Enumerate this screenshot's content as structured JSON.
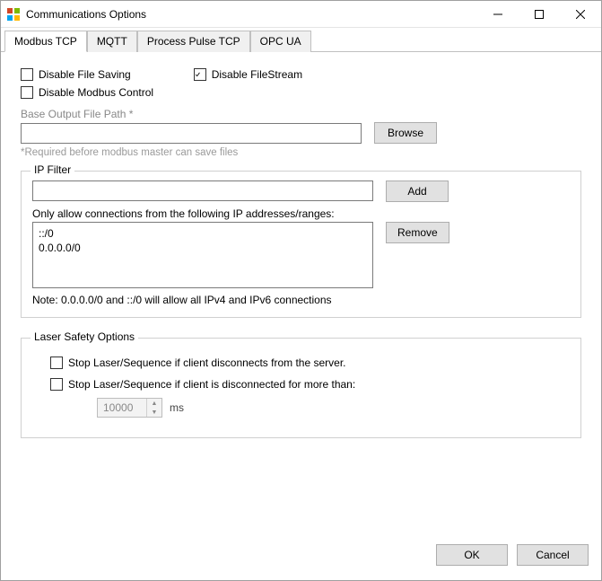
{
  "window": {
    "title": "Communications Options"
  },
  "tabs": {
    "items": [
      {
        "label": "Modbus TCP",
        "active": true
      },
      {
        "label": "MQTT",
        "active": false
      },
      {
        "label": "Process Pulse TCP",
        "active": false
      },
      {
        "label": "OPC UA",
        "active": false
      }
    ]
  },
  "options": {
    "disable_file_saving": {
      "label": "Disable File Saving",
      "checked": false
    },
    "disable_filestream": {
      "label": "Disable FileStream",
      "checked": true
    },
    "disable_modbus_control": {
      "label": "Disable Modbus Control",
      "checked": false
    }
  },
  "base_output": {
    "label": "Base Output File Path *",
    "value": "",
    "browse": "Browse",
    "hint": "*Required before modbus master can save files"
  },
  "ip_filter": {
    "legend": "IP Filter",
    "input_value": "",
    "add": "Add",
    "list_label": "Only allow connections from the following IP addresses/ranges:",
    "entries": [
      "::/0",
      "0.0.0.0/0"
    ],
    "remove": "Remove",
    "note": "Note: 0.0.0.0/0 and  ::/0 will allow all IPv4 and IPv6 connections"
  },
  "laser": {
    "legend": "Laser Safety Options",
    "opt1": {
      "label": "Stop Laser/Sequence if client disconnects from the server.",
      "checked": false
    },
    "opt2": {
      "label": "Stop Laser/Sequence if client is disconnected for more than:",
      "checked": false
    },
    "timeout_value": "10000",
    "timeout_unit": "ms"
  },
  "buttons": {
    "ok": "OK",
    "cancel": "Cancel"
  }
}
